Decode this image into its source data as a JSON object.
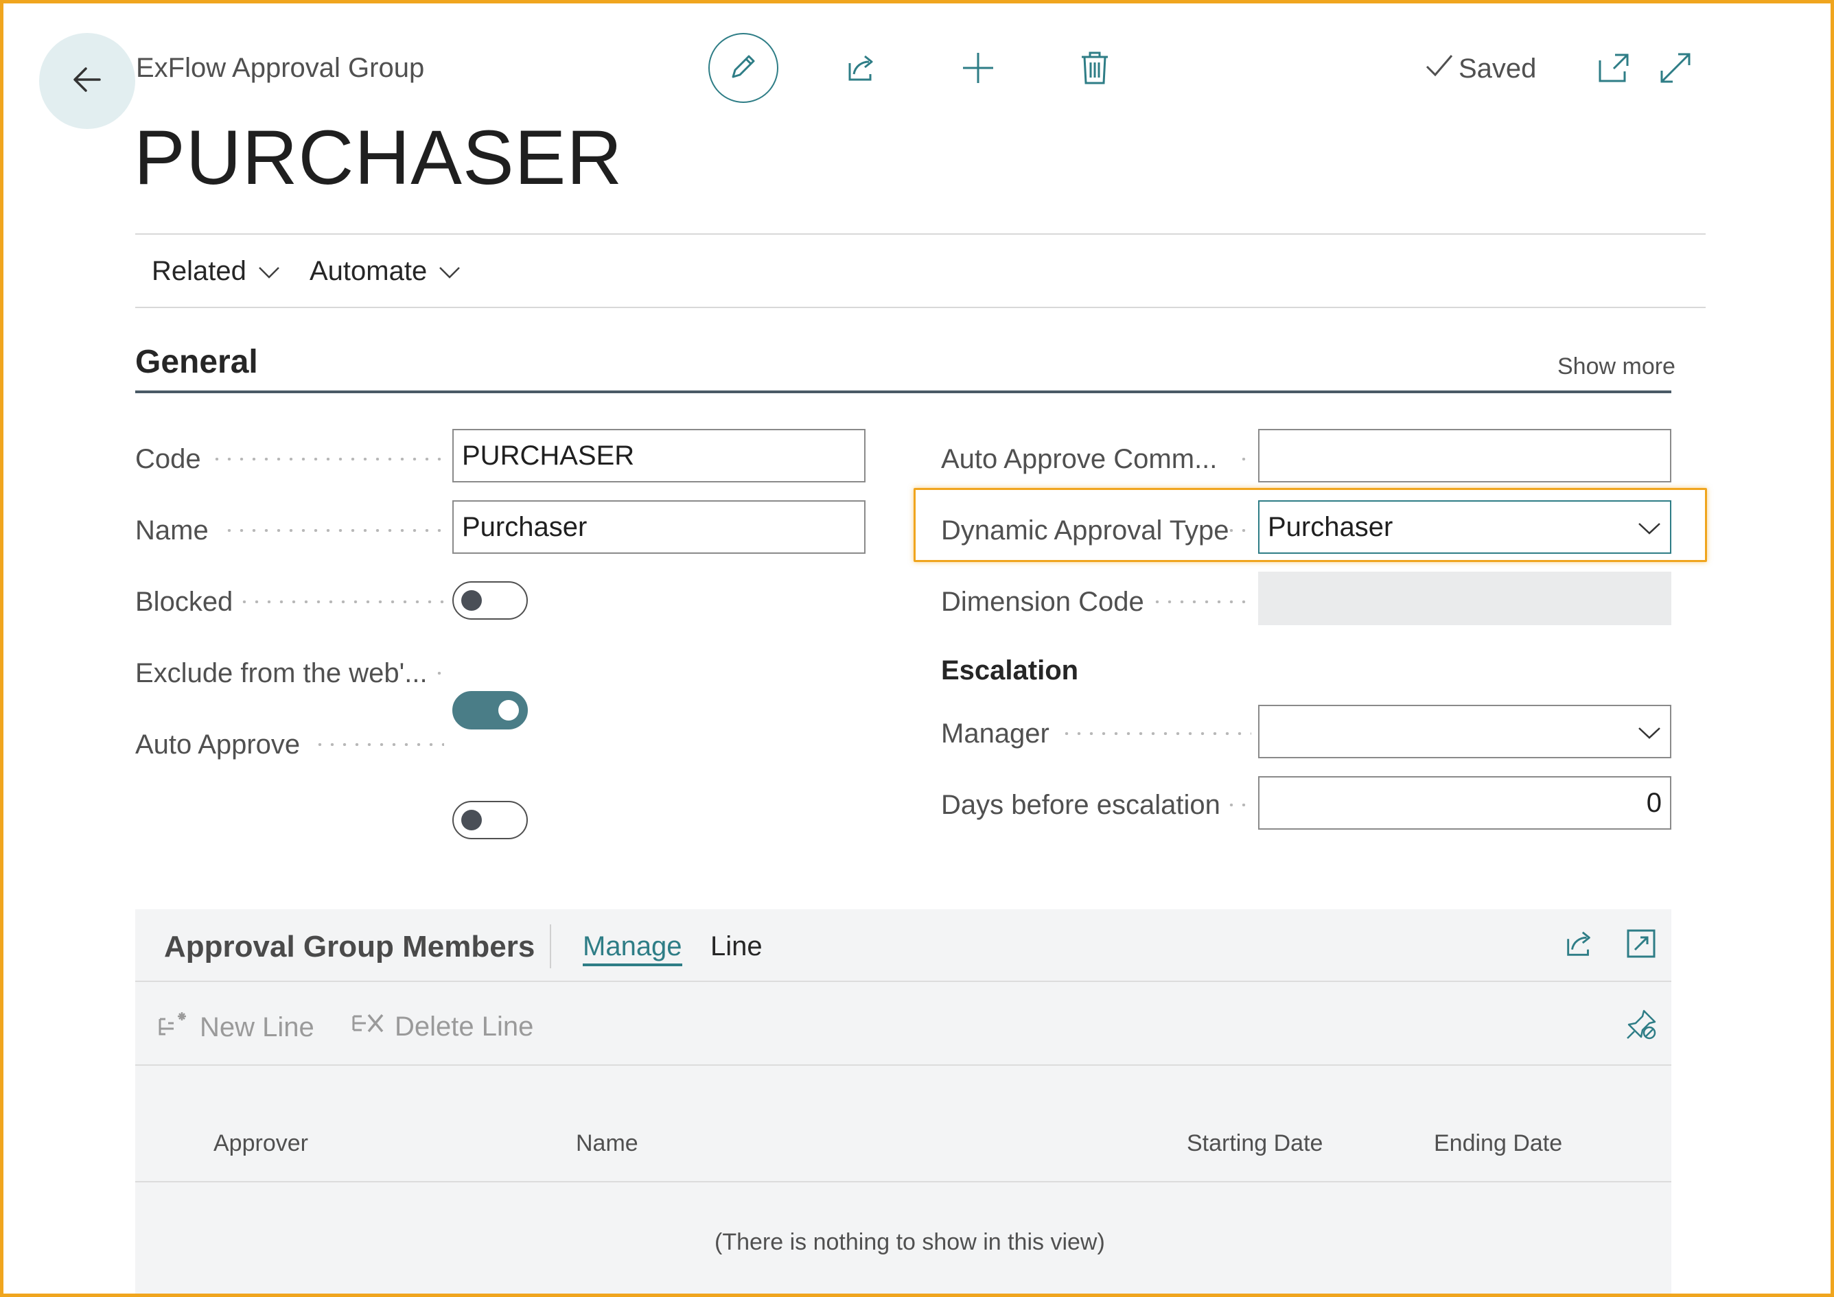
{
  "header": {
    "breadcrumb": "ExFlow Approval Group",
    "title": "PURCHASER",
    "saved_label": "Saved",
    "icons": [
      "back-arrow-icon",
      "pencil-icon",
      "share-icon",
      "plus-icon",
      "trash-icon",
      "checkmark-icon",
      "open-new-window-icon",
      "expand-icon"
    ]
  },
  "menu": {
    "items": [
      {
        "label": "Related"
      },
      {
        "label": "Automate"
      }
    ]
  },
  "general": {
    "title": "General",
    "show_more": "Show more",
    "left": {
      "code": {
        "label": "Code",
        "value": "PURCHASER"
      },
      "name": {
        "label": "Name",
        "value": "Purchaser"
      },
      "blocked": {
        "label": "Blocked",
        "on": false
      },
      "exclude_web": {
        "label": "Exclude from the web'...",
        "on": true
      },
      "auto_approve": {
        "label": "Auto Approve",
        "on": false
      }
    },
    "right": {
      "auto_approve_comment": {
        "label": "Auto Approve Comm...",
        "value": ""
      },
      "dynamic_approval_type": {
        "label": "Dynamic Approval Type",
        "value": "Purchaser"
      },
      "dimension_code": {
        "label": "Dimension Code",
        "value": ""
      }
    },
    "escalation": {
      "title": "Escalation",
      "manager": {
        "label": "Manager",
        "value": ""
      },
      "days_before_escalation": {
        "label": "Days before escalation",
        "value": "0"
      }
    }
  },
  "members": {
    "title": "Approval Group Members",
    "tabs": [
      "Manage",
      "Line"
    ],
    "active_tab": "Manage",
    "actions": {
      "new_line": "New Line",
      "delete_line": "Delete Line"
    },
    "columns": [
      "Approver",
      "Name",
      "Starting Date",
      "Ending Date"
    ],
    "empty_message": "(There is nothing to show in this view)"
  },
  "colors": {
    "accent": "#2e7d86",
    "highlight": "#f0a51e"
  }
}
